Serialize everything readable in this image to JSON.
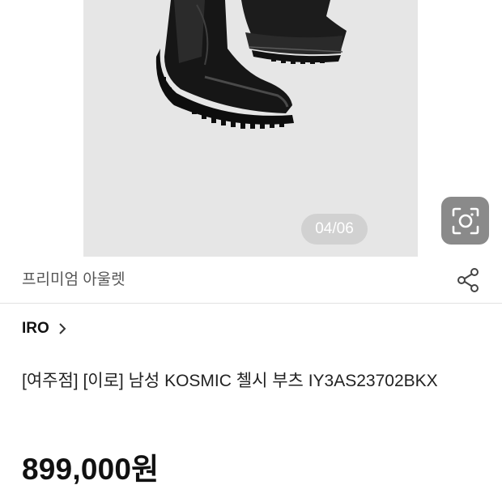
{
  "gallery": {
    "counter": "04/06",
    "lens_icon": "camera-search-icon"
  },
  "store": {
    "label": "프리미엄 아울렛",
    "share_icon": "share-icon"
  },
  "brand": {
    "name": "IRO",
    "chevron_icon": "chevron-right-icon"
  },
  "product": {
    "title": "[여주점] [이로] 남성 KOSMIC 첼시 부츠 IY3AS23702BKX",
    "price": "899,000원"
  }
}
